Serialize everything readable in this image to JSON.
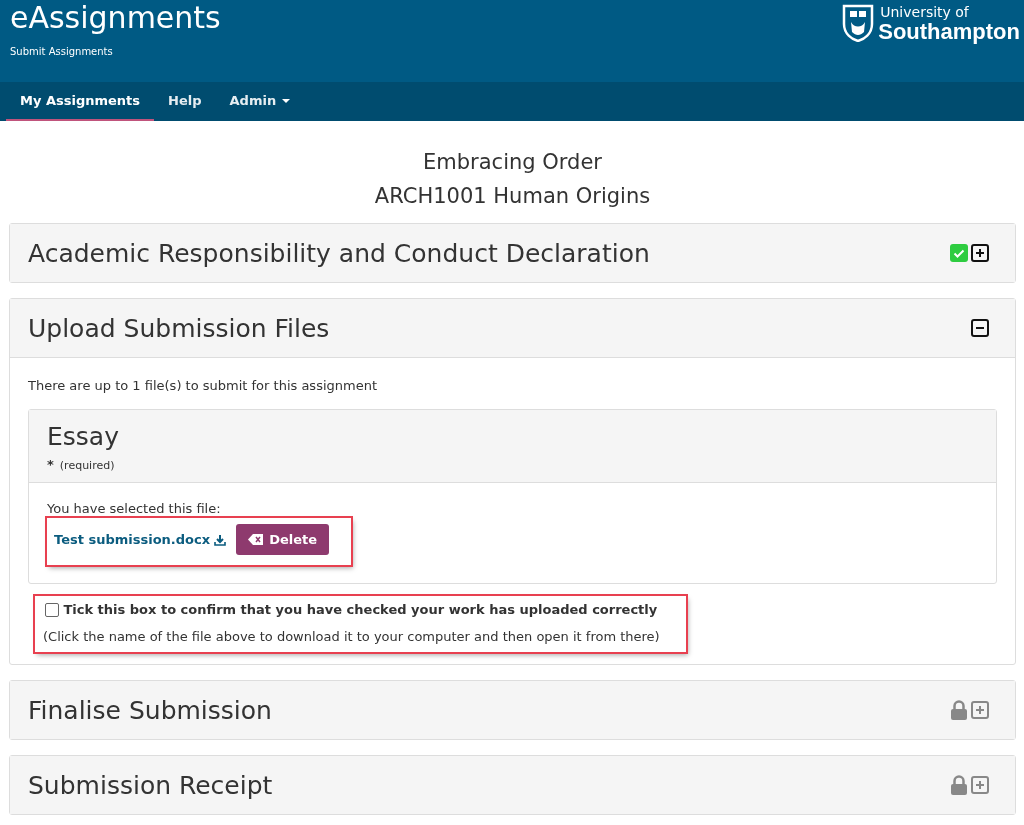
{
  "header": {
    "title": "eAssignments",
    "subtitle": "Submit Assignments",
    "logo": {
      "line1": "University of",
      "line2": "Southampton"
    }
  },
  "nav": [
    {
      "label": "My Assignments",
      "selected": true,
      "dropdown": false
    },
    {
      "label": "Help",
      "selected": false,
      "dropdown": false
    },
    {
      "label": "Admin",
      "selected": false,
      "dropdown": true
    }
  ],
  "heading": [
    "Embracing Order",
    "ARCH1001 Human Origins"
  ],
  "panels": [
    {
      "title": "Academic Responsibility and Conduct Declaration",
      "completed": true,
      "locked": false,
      "expanded": false
    },
    {
      "title": "Upload Submission Files",
      "completed": false,
      "locked": false,
      "expanded": true,
      "body": {
        "intro": "There are up to 1 file(s) to submit for this assignment",
        "file_slot": {
          "title": "Essay",
          "required_mark": "*",
          "required_note": "(required)",
          "selected_label": "You have selected this file:",
          "file_name": "Test submission.docx",
          "delete_button": "Delete",
          "highlighted": true
        },
        "confirm": {
          "checked": false,
          "label": "Tick this box to confirm that you have checked your work has uploaded correctly",
          "hint": "(Click the name of the file above to download it to your computer and then open it from there)",
          "highlighted": true
        }
      }
    },
    {
      "title": "Finalise Submission",
      "completed": false,
      "locked": true,
      "expanded": false
    },
    {
      "title": "Submission Receipt",
      "completed": false,
      "locked": true,
      "expanded": false
    }
  ]
}
